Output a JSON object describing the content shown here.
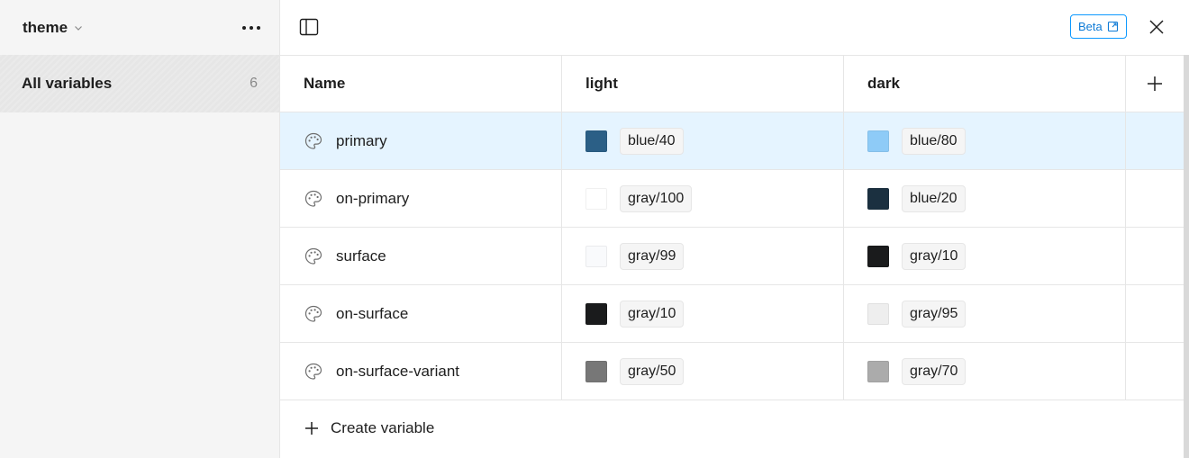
{
  "sidebar": {
    "collection_name": "theme",
    "items": [
      {
        "label": "All variables",
        "count": "6"
      }
    ]
  },
  "toolbar": {
    "beta_label": "Beta"
  },
  "table": {
    "columns": [
      "Name",
      "light",
      "dark"
    ],
    "rows": [
      {
        "name": "primary",
        "light": {
          "label": "blue/40",
          "color": "#2b5f86"
        },
        "dark": {
          "label": "blue/80",
          "color": "#8ecbf7"
        },
        "selected": true
      },
      {
        "name": "on-primary",
        "light": {
          "label": "gray/100",
          "color": "#ffffff"
        },
        "dark": {
          "label": "blue/20",
          "color": "#1b3040"
        },
        "selected": false
      },
      {
        "name": "surface",
        "light": {
          "label": "gray/99",
          "color": "#f9fafc"
        },
        "dark": {
          "label": "gray/10",
          "color": "#1a1b1c"
        },
        "selected": false
      },
      {
        "name": "on-surface",
        "light": {
          "label": "gray/10",
          "color": "#1a1b1c"
        },
        "dark": {
          "label": "gray/95",
          "color": "#eeeeee"
        },
        "selected": false
      },
      {
        "name": "on-surface-variant",
        "light": {
          "label": "gray/50",
          "color": "#777777"
        },
        "dark": {
          "label": "gray/70",
          "color": "#ababab"
        },
        "selected": false
      }
    ]
  },
  "footer": {
    "create_label": "Create variable"
  },
  "colors": {
    "accent": "#0d99ff",
    "selected_row": "#e5f4ff",
    "sidebar_bg": "#f5f5f5"
  }
}
